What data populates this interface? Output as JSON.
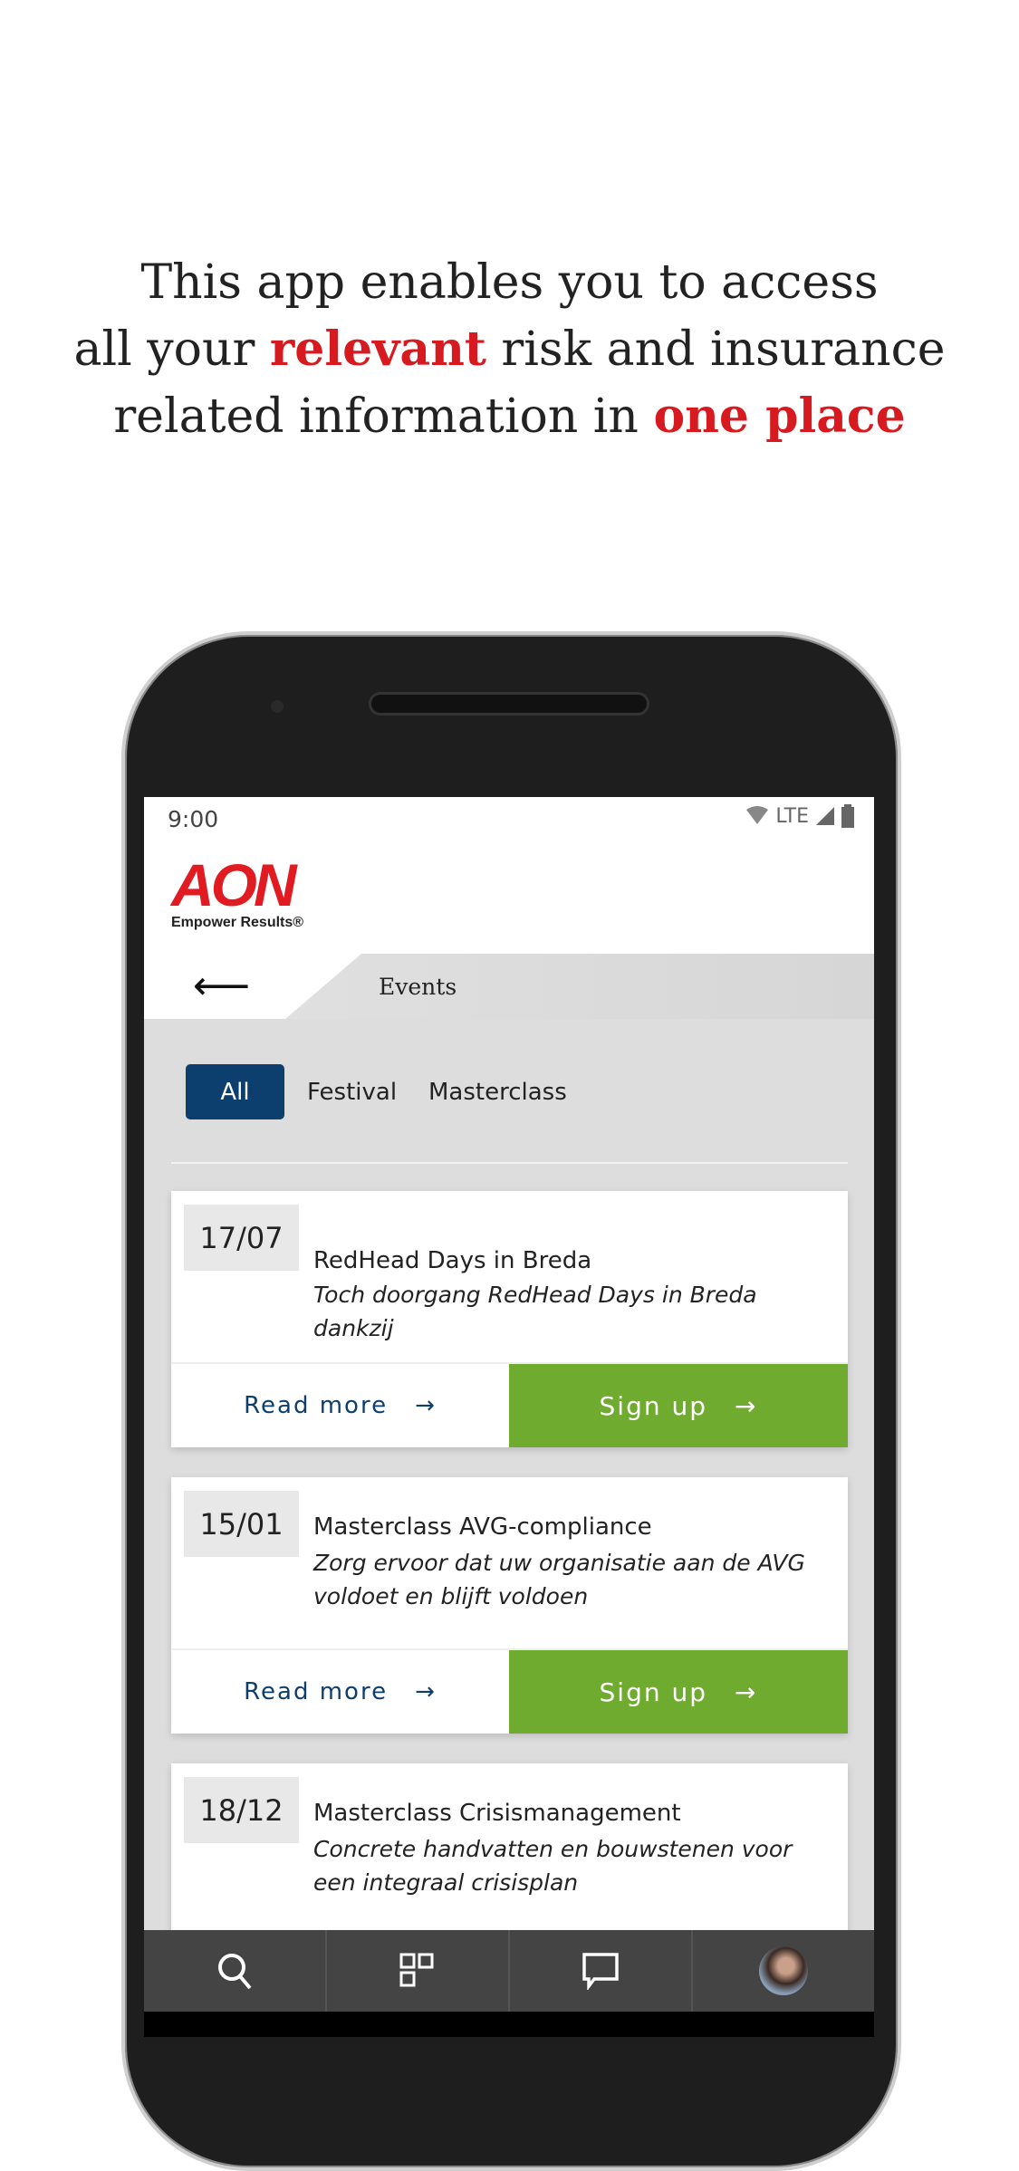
{
  "headline": {
    "line1": "This app enables you to access",
    "line2_pre": "all your ",
    "line2_hl": "relevant",
    "line2_post": " risk and insurance",
    "line3_pre": "related information in ",
    "line3_hl": "one place"
  },
  "status": {
    "time": "9:00",
    "network": "LTE"
  },
  "brand": {
    "logo": "AON",
    "tagline": "Empower Results®"
  },
  "nav": {
    "title": "Events"
  },
  "filters": [
    {
      "label": "All",
      "active": true
    },
    {
      "label": "Festival",
      "active": false
    },
    {
      "label": "Masterclass",
      "active": false
    }
  ],
  "events": [
    {
      "date": "17/07",
      "title": "RedHead Days in Breda",
      "subtitle": "Toch doorgang RedHead Days in Breda dankzij",
      "read_more": "Read more",
      "sign_up": "Sign up"
    },
    {
      "date": "15/01",
      "title": "Masterclass AVG-compliance",
      "subtitle": "Zorg ervoor dat uw organisatie aan de AVG voldoet en blijft voldoen",
      "read_more": "Read more",
      "sign_up": "Sign up"
    },
    {
      "date": "18/12",
      "title": "Masterclass Crisismanagement",
      "subtitle": "Concrete handvatten en bouwstenen voor een integraal crisisplan"
    }
  ],
  "tabbar": [
    "search-icon",
    "grid-icon",
    "chat-icon",
    "avatar"
  ],
  "colors": {
    "accent_red": "#d71920",
    "primary_blue": "#0d3f6e",
    "signup_green": "#6fab2f"
  }
}
